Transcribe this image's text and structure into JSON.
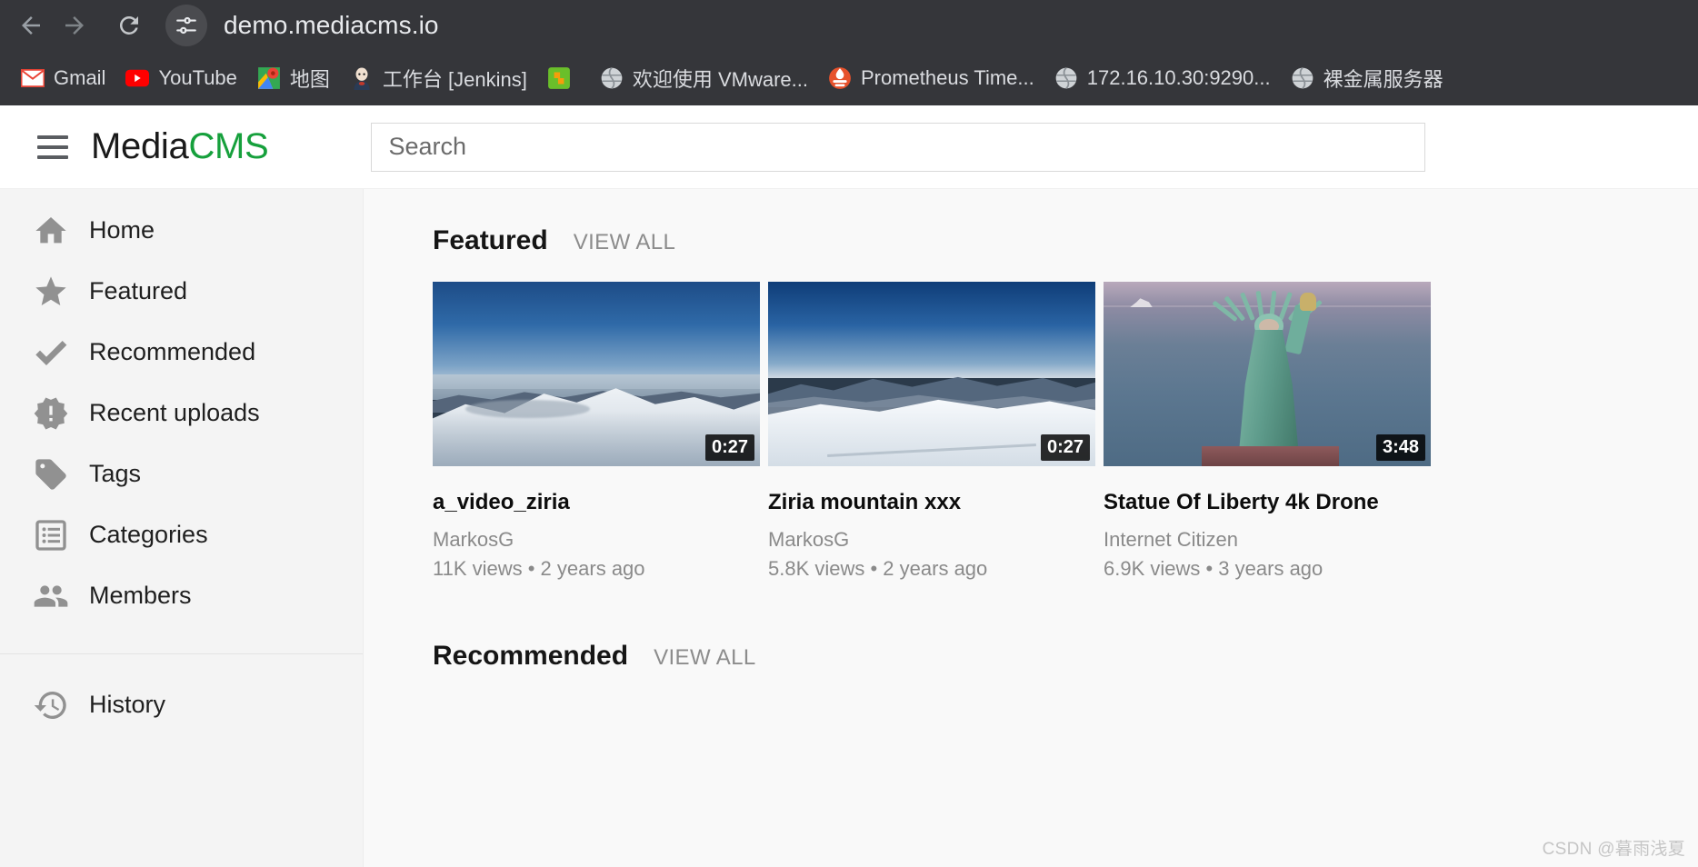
{
  "browser": {
    "back_icon": "arrow-left-icon",
    "forward_icon": "arrow-right-icon",
    "reload_icon": "reload-icon",
    "site_info_icon": "site-settings-icon",
    "url": "demo.mediacms.io",
    "bookmarks": [
      {
        "label": "Gmail",
        "icon": "gmail-icon"
      },
      {
        "label": "YouTube",
        "icon": "youtube-icon"
      },
      {
        "label": "地图",
        "icon": "google-maps-icon"
      },
      {
        "label": "工作台 [Jenkins]",
        "icon": "jenkins-icon"
      },
      {
        "label": "",
        "icon": "green-app-icon"
      },
      {
        "label": "欢迎使用 VMware...",
        "icon": "globe-icon"
      },
      {
        "label": "Prometheus Time...",
        "icon": "prometheus-icon"
      },
      {
        "label": "172.16.10.30:9290...",
        "icon": "globe-icon"
      },
      {
        "label": "裸金属服务器",
        "icon": "globe-icon"
      }
    ]
  },
  "header": {
    "menu_icon": "hamburger-menu-icon",
    "brand_primary": "Media",
    "brand_accent": "CMS",
    "brand_accent_color": "#16a03c",
    "search_placeholder": "Search",
    "search_value": ""
  },
  "sidebar": {
    "items": [
      {
        "label": "Home",
        "icon": "home-icon"
      },
      {
        "label": "Featured",
        "icon": "star-icon"
      },
      {
        "label": "Recommended",
        "icon": "check-icon"
      },
      {
        "label": "Recent uploads",
        "icon": "new-releases-icon"
      },
      {
        "label": "Tags",
        "icon": "tag-icon"
      },
      {
        "label": "Categories",
        "icon": "list-icon"
      },
      {
        "label": "Members",
        "icon": "people-icon"
      }
    ],
    "bottom_items": [
      {
        "label": "History",
        "icon": "history-icon"
      }
    ]
  },
  "main": {
    "sections": [
      {
        "title": "Featured",
        "view_all": "VIEW ALL",
        "cards": [
          {
            "title": "a_video_ziria",
            "author": "MarkosG",
            "meta": "11K views • 2 years ago",
            "duration": "0:27",
            "scene": "snowy-mountain-ridge"
          },
          {
            "title": "Ziria mountain xxx",
            "author": "MarkosG",
            "meta": "5.8K views • 2 years ago",
            "duration": "0:27",
            "scene": "mountain-snowfield"
          },
          {
            "title": "Statue Of Liberty 4k Drone",
            "author": "Internet Citizen",
            "meta": "6.9K views • 3 years ago",
            "duration": "3:48",
            "scene": "statue-of-liberty-aerial"
          }
        ]
      },
      {
        "title": "Recommended",
        "view_all": "VIEW ALL",
        "cards": []
      }
    ]
  },
  "watermark": "CSDN @暮雨浅夏"
}
